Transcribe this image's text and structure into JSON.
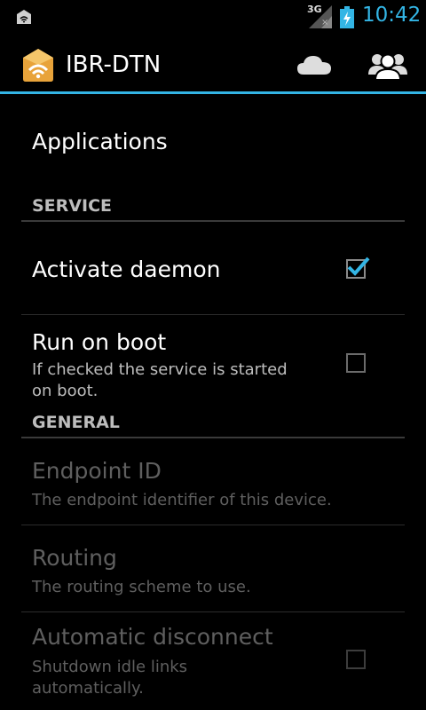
{
  "status_bar": {
    "network_type": "3G",
    "time": "10:42"
  },
  "action_bar": {
    "title": "IBR-DTN"
  },
  "list": {
    "applications": {
      "title": "Applications"
    },
    "service_header": "SERVICE",
    "activate_daemon": {
      "title": "Activate daemon",
      "checked": true
    },
    "run_on_boot": {
      "title": "Run on boot",
      "summary": "If checked the service is started on boot.",
      "checked": false
    },
    "general_header": "GENERAL",
    "endpoint_id": {
      "title": "Endpoint ID",
      "summary": "The endpoint identifier of this device.",
      "enabled": false
    },
    "routing": {
      "title": "Routing",
      "summary": "The routing scheme to use.",
      "enabled": false
    },
    "auto_disconnect": {
      "title": "Automatic disconnect",
      "summary": "Shutdown idle links automatically.",
      "enabled": false,
      "checked": false
    }
  },
  "colors": {
    "accent": "#33b5e5",
    "background": "#000000"
  }
}
